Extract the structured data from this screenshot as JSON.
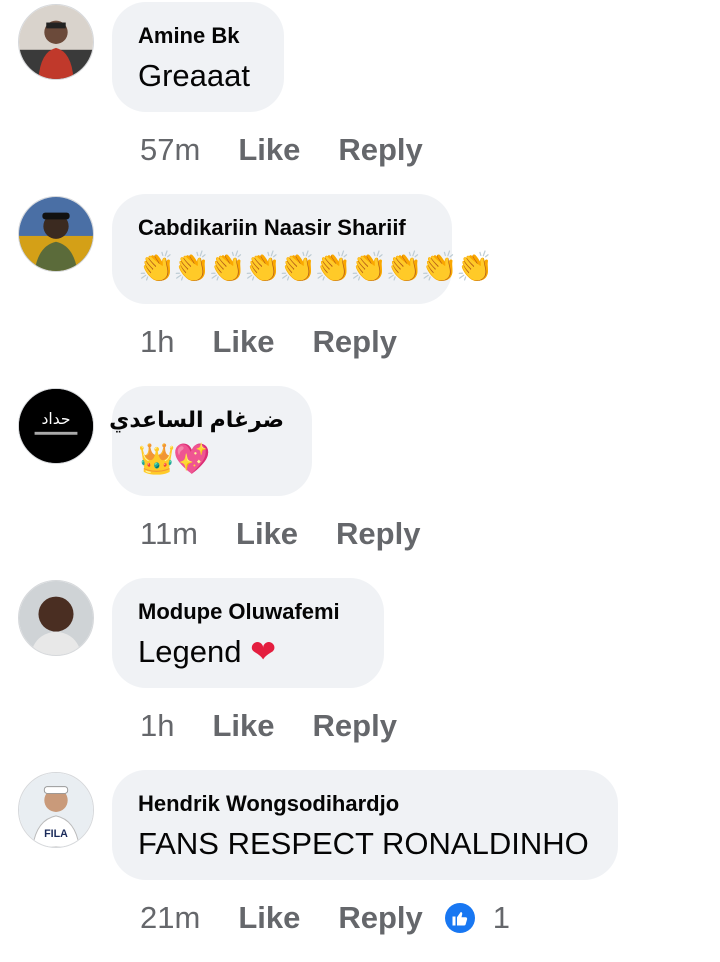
{
  "comments": [
    {
      "author": "Amine Bk",
      "text": "Greaaat",
      "time": "57m",
      "like_label": "Like",
      "reply_label": "Reply",
      "avatar_color": "#c0392b"
    },
    {
      "author": "Cabdikariin Naasir Shariif",
      "text": "👏👏👏👏👏👏👏👏👏👏",
      "time": "1h",
      "like_label": "Like",
      "reply_label": "Reply",
      "avatar_color": "#d4a017"
    },
    {
      "author": "ضرغام الساعدي",
      "text": "👑💖",
      "time": "11m",
      "like_label": "Like",
      "reply_label": "Reply",
      "avatar_color": "#000000",
      "avatar_text": "حداد"
    },
    {
      "author": "Modupe Oluwafemi",
      "text": "Legend",
      "text_emoji": "❤",
      "time": "1h",
      "like_label": "Like",
      "reply_label": "Reply",
      "avatar_color": "#6b4a3a"
    },
    {
      "author": "Hendrik Wongsodihardjo",
      "text": "FANS RESPECT RONALDINHO",
      "time": "21m",
      "like_label": "Like",
      "reply_label": "Reply",
      "avatar_color": "#e9eef2",
      "reaction_icon": "thumbs-up-icon",
      "reaction_count": "1"
    }
  ],
  "colors": {
    "bubble_bg": "#f0f2f5",
    "secondary_text": "#65676b",
    "like_blue": "#1877f2",
    "heart_red": "#e41e3f"
  }
}
